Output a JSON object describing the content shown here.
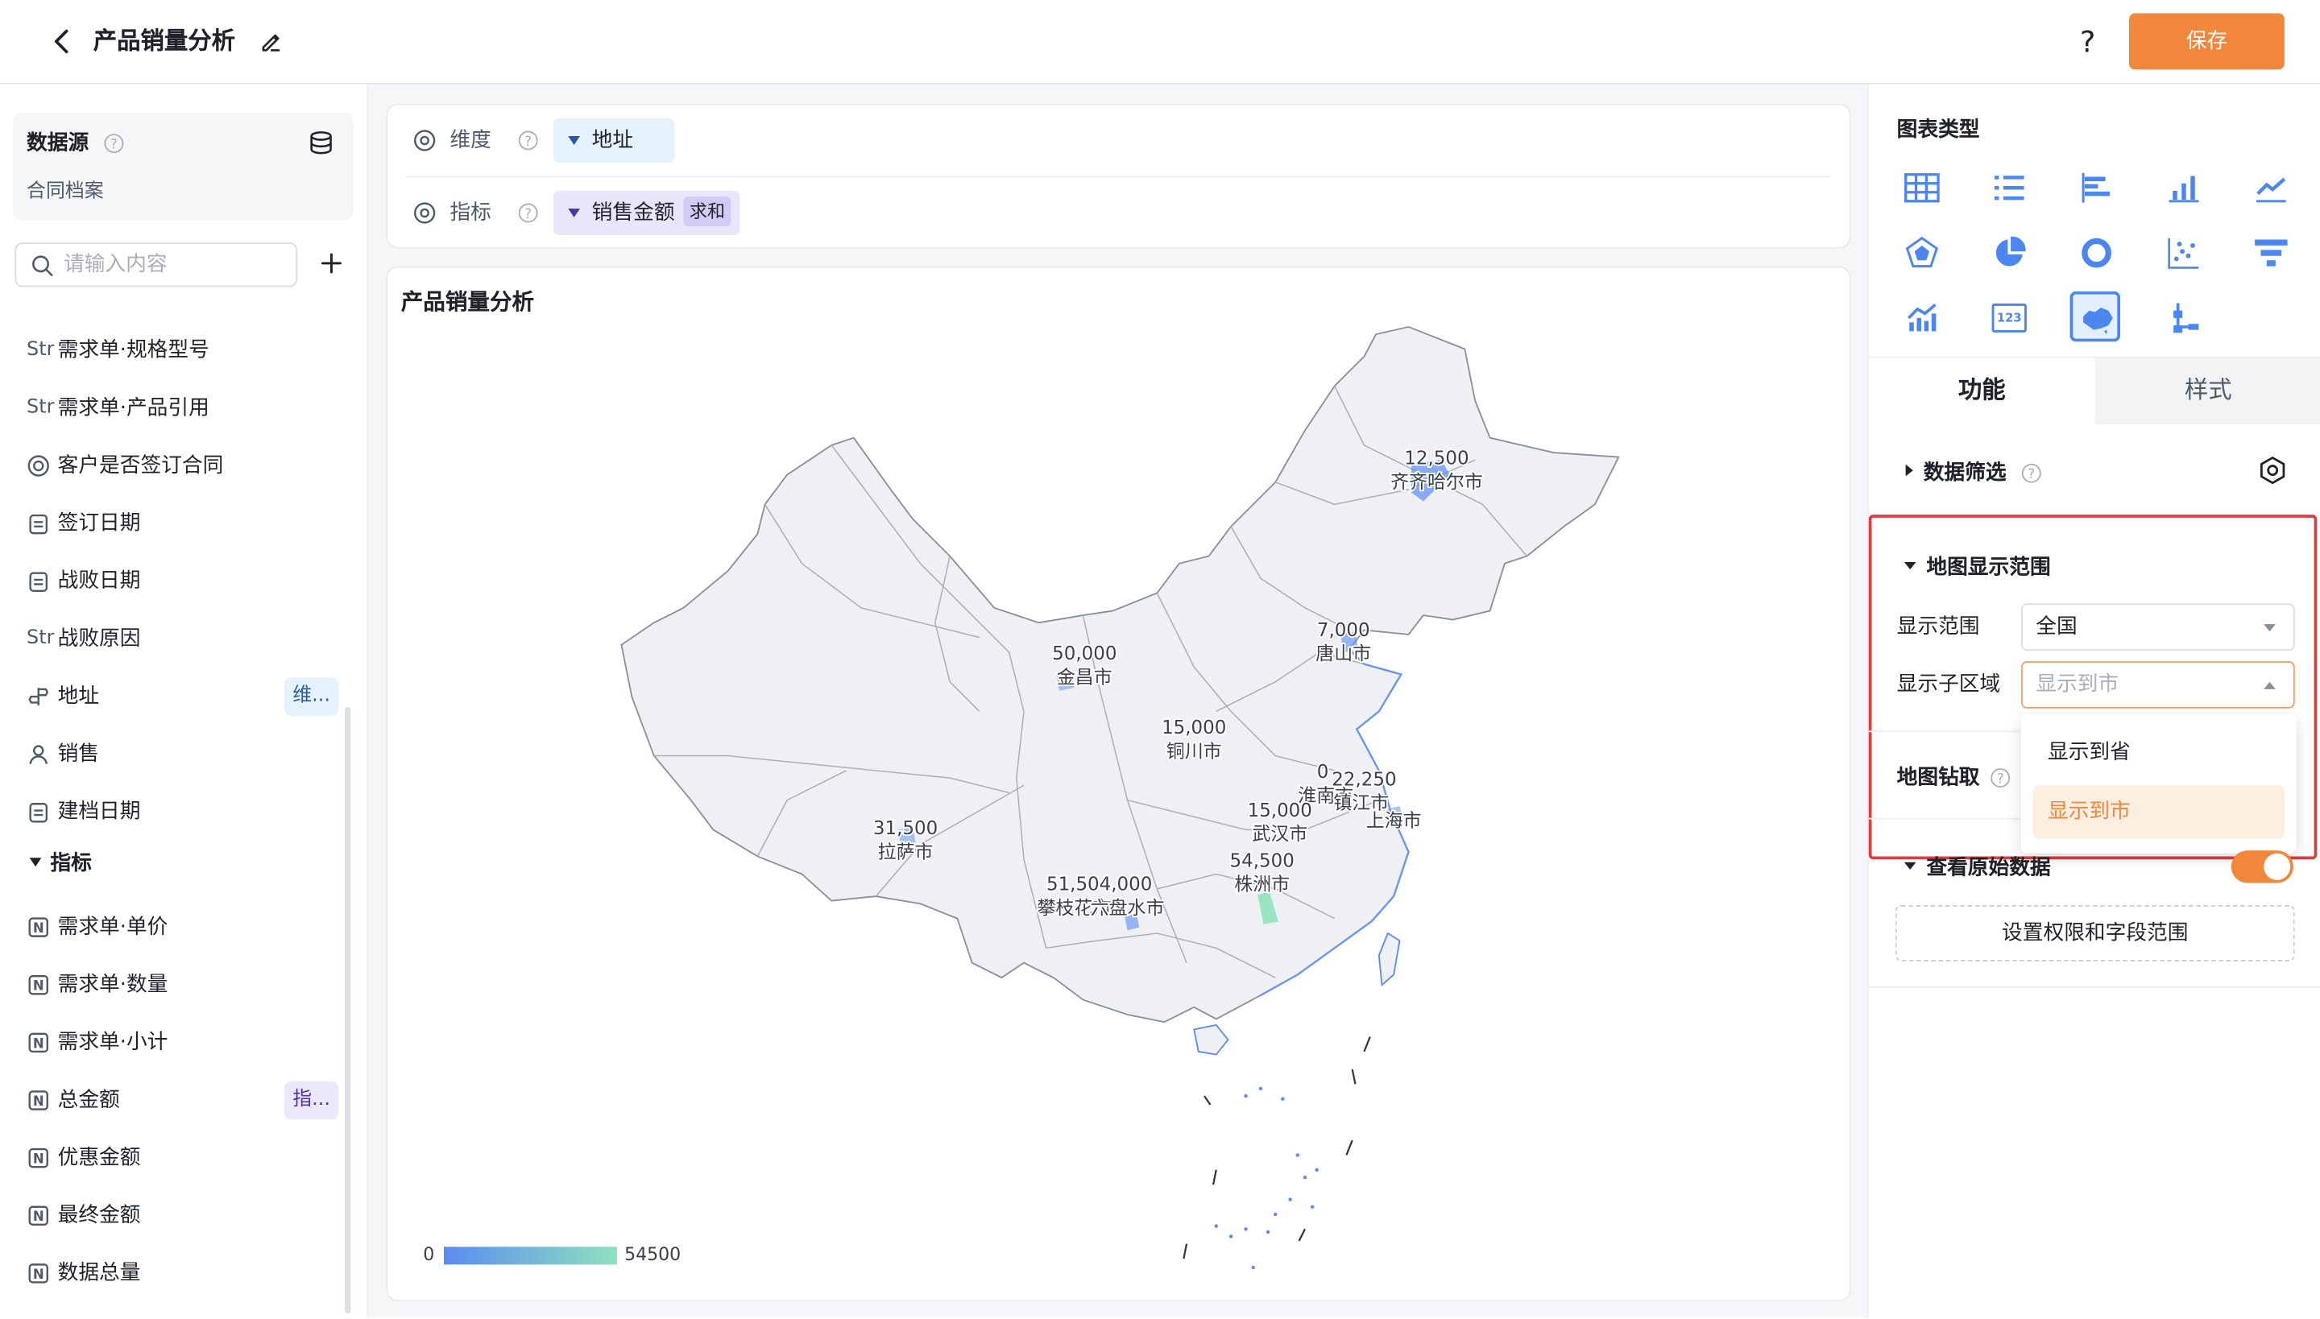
{
  "header": {
    "title": "产品销量分析",
    "help": "?",
    "save_label": "保存"
  },
  "datasource": {
    "title": "数据源",
    "name": "合同档案"
  },
  "search": {
    "placeholder": "请输入内容"
  },
  "fields": [
    {
      "type": "Str",
      "icon": "",
      "label": "需求单·规格型号",
      "badge": ""
    },
    {
      "type": "Str",
      "icon": "",
      "label": "需求单·产品引用",
      "badge": ""
    },
    {
      "type": "",
      "icon": "radio-icon",
      "label": "客户是否签订合同",
      "badge": ""
    },
    {
      "type": "",
      "icon": "calendar-icon",
      "label": "签订日期",
      "badge": ""
    },
    {
      "type": "",
      "icon": "calendar-icon",
      "label": "战败日期",
      "badge": ""
    },
    {
      "type": "Str",
      "icon": "",
      "label": "战败原因",
      "badge": ""
    },
    {
      "type": "",
      "icon": "location-icon",
      "label": "地址",
      "badge": "维..."
    },
    {
      "type": "",
      "icon": "user-icon",
      "label": "销售",
      "badge": ""
    },
    {
      "type": "",
      "icon": "calendar-icon",
      "label": "建档日期",
      "badge": ""
    }
  ],
  "metric_group": "指标",
  "metrics": [
    {
      "label": "需求单·单价",
      "badge": ""
    },
    {
      "label": "需求单·数量",
      "badge": ""
    },
    {
      "label": "需求单·小计",
      "badge": ""
    },
    {
      "label": "总金额",
      "badge": "指..."
    },
    {
      "label": "优惠金额",
      "badge": ""
    },
    {
      "label": "最终金额",
      "badge": ""
    },
    {
      "label": "数据总量",
      "badge": ""
    }
  ],
  "config": {
    "dimension_label": "维度",
    "dimension_value": "地址",
    "metric_label": "指标",
    "metric_value": "销售金额",
    "metric_agg": "求和"
  },
  "chart": {
    "title": "产品销量分析",
    "legend_min": "0",
    "legend_max": "54500"
  },
  "chart_data": {
    "type": "map",
    "region": "全国",
    "level": "市",
    "points": [
      {
        "city": "齐齐哈尔市",
        "value": "12,500"
      },
      {
        "city": "唐山市",
        "value": "7,000"
      },
      {
        "city": "金昌市",
        "value": "50,000"
      },
      {
        "city": "铜川市",
        "value": "15,000"
      },
      {
        "city": "拉萨市",
        "value": "31,500"
      },
      {
        "city": "淮南市",
        "value": "0"
      },
      {
        "city": "镇江市",
        "value": "22,250"
      },
      {
        "city": "武汉市",
        "value": "15,000"
      },
      {
        "city": "上海市",
        "value": ""
      },
      {
        "city": "株洲市",
        "value": "54,500"
      },
      {
        "city": "攀枝花市",
        "value": "51,504,000"
      },
      {
        "city": "六盘水市",
        "value": ""
      }
    ],
    "colors": {
      "low": "#5b8bf2",
      "high": "#8ee2be"
    }
  },
  "right": {
    "chart_type_title": "图表类型",
    "tab_function": "功能",
    "tab_style": "样式",
    "data_filter": "数据筛选",
    "map_range_section": "地图显示范围",
    "range_label": "显示范围",
    "range_value": "全国",
    "subregion_label": "显示子区域",
    "subregion_placeholder": "显示到市",
    "options": [
      "显示到省",
      "显示到市"
    ],
    "drill_label": "地图钻取",
    "raw_data_label": "查看原始数据",
    "permission_button": "设置权限和字段范围"
  },
  "icons": [
    "back-icon",
    "edit-icon",
    "database-icon",
    "search-icon",
    "plus-icon",
    "settings-icon"
  ]
}
